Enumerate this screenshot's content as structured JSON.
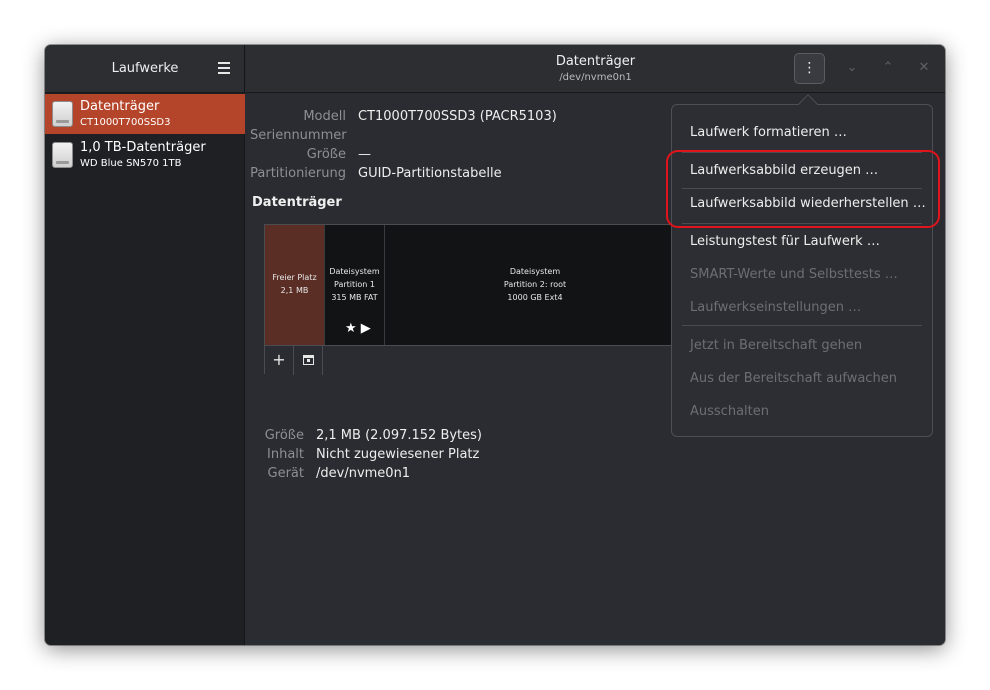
{
  "sidebar": {
    "title": "Laufwerke",
    "drives": [
      {
        "name": "Datenträger",
        "model": "CT1000T700SSD3",
        "selected": true
      },
      {
        "name": "1,0 TB-Datenträger",
        "model": "WD Blue SN570 1TB",
        "selected": false
      }
    ]
  },
  "header": {
    "title": "Datenträger",
    "subtitle": "/dev/nvme0n1",
    "menu_icon": "⋮",
    "minimize_icon": "⌄",
    "maximize_icon": "⌃",
    "close_icon": "✕"
  },
  "properties": {
    "model_label": "Modell",
    "model_value": "CT1000T700SSD3 (PACR5103)",
    "serial_label": "Seriennummer",
    "serial_value": "",
    "size_label": "Größe",
    "size_value": "—",
    "partitioning_label": "Partitionierung",
    "partitioning_value": "GUID-Partitionstabelle"
  },
  "volumes": {
    "section_title": "Datenträger",
    "free": {
      "line1": "Freier Platz",
      "line2": "2,1 MB"
    },
    "p1": {
      "line1": "Dateisystem",
      "line2": "Partition 1",
      "line3": "315 MB FAT"
    },
    "p2": {
      "line1": "Dateisystem",
      "line2": "Partition 2: root",
      "line3": "1000 GB Ext4"
    },
    "star_icon": "★",
    "play_icon": "▶",
    "add_icon": "+"
  },
  "details": {
    "size_label": "Größe",
    "size_value": "2,1 MB (2.097.152 Bytes)",
    "content_label": "Inhalt",
    "content_value": "Nicht zugewiesener Platz",
    "device_label": "Gerät",
    "device_value": "/dev/nvme0n1"
  },
  "menu": {
    "format": "Laufwerk formatieren …",
    "create_image": "Laufwerksabbild erzeugen …",
    "restore_image": "Laufwerksabbild wiederherstellen …",
    "benchmark": "Leistungstest für Laufwerk …",
    "smart": "SMART-Werte und Selbsttests …",
    "settings": "Laufwerkseinstellungen …",
    "standby": "Jetzt in Bereitschaft gehen",
    "wakeup": "Aus der Bereitschaft aufwachen",
    "poweroff": "Ausschalten"
  },
  "colors": {
    "selected_accent": "#b5452a",
    "highlight_ring": "#e0141a"
  }
}
